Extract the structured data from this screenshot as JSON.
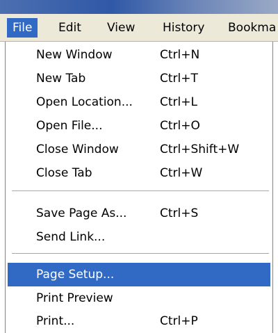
{
  "menubar": {
    "items": [
      {
        "label": "File"
      },
      {
        "label": "Edit"
      },
      {
        "label": "View"
      },
      {
        "label": "History"
      },
      {
        "label": "Bookma"
      }
    ]
  },
  "file_menu": {
    "items": [
      {
        "label": "New Window",
        "shortcut": "Ctrl+N"
      },
      {
        "label": "New Tab",
        "shortcut": "Ctrl+T"
      },
      {
        "label": "Open Location...",
        "shortcut": "Ctrl+L"
      },
      {
        "label": "Open File...",
        "shortcut": "Ctrl+O"
      },
      {
        "label": "Close Window",
        "shortcut": "Ctrl+Shift+W"
      },
      {
        "label": "Close Tab",
        "shortcut": "Ctrl+W"
      },
      {
        "label": "Save Page As...",
        "shortcut": "Ctrl+S"
      },
      {
        "label": "Send Link...",
        "shortcut": ""
      },
      {
        "label": "Page Setup...",
        "shortcut": ""
      },
      {
        "label": "Print Preview",
        "shortcut": ""
      },
      {
        "label": "Print...",
        "shortcut": "Ctrl+P"
      }
    ],
    "highlighted_item": "Page Setup..."
  },
  "colors": {
    "highlight": "#316ac5",
    "menubar_bg": "#ece9d8",
    "menu_bg": "#ffffff",
    "separator": "#a7a6aa"
  }
}
